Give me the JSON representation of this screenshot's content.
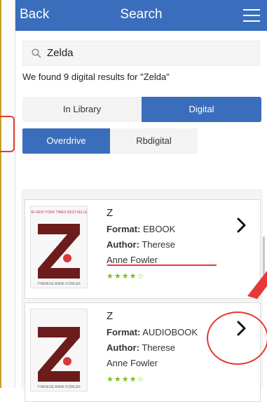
{
  "header": {
    "back_label": "Back",
    "title": "Search"
  },
  "search": {
    "value": "Zelda"
  },
  "results": {
    "summary": "We found 9 digital results for \"Zelda\""
  },
  "tabs": {
    "in_library": "In Library",
    "digital": "Digital"
  },
  "providers": {
    "overdrive": "Overdrive",
    "rbdigital": "Rbdigital"
  },
  "items": [
    {
      "title": "Z",
      "format_label": "Format:",
      "format_value": "EBOOK",
      "author_label": "Author:",
      "author_value_line1": "Therese",
      "author_value_line2": "Anne Fowler",
      "rating_stars": "★★★★☆"
    },
    {
      "title": "Z",
      "format_label": "Format:",
      "format_value": "AUDIOBOOK",
      "author_label": "Author:",
      "author_value_line1": "Therese",
      "author_value_line2": "Anne Fowler",
      "rating_stars": "★★★★☆"
    }
  ],
  "colors": {
    "brand_blue": "#3a6ebc",
    "annotation_red": "#e53935",
    "rating_green": "#7bbf1e"
  },
  "icons": {
    "menu": "menu-icon",
    "search": "search-icon",
    "chevron": "chevron-right-icon"
  }
}
